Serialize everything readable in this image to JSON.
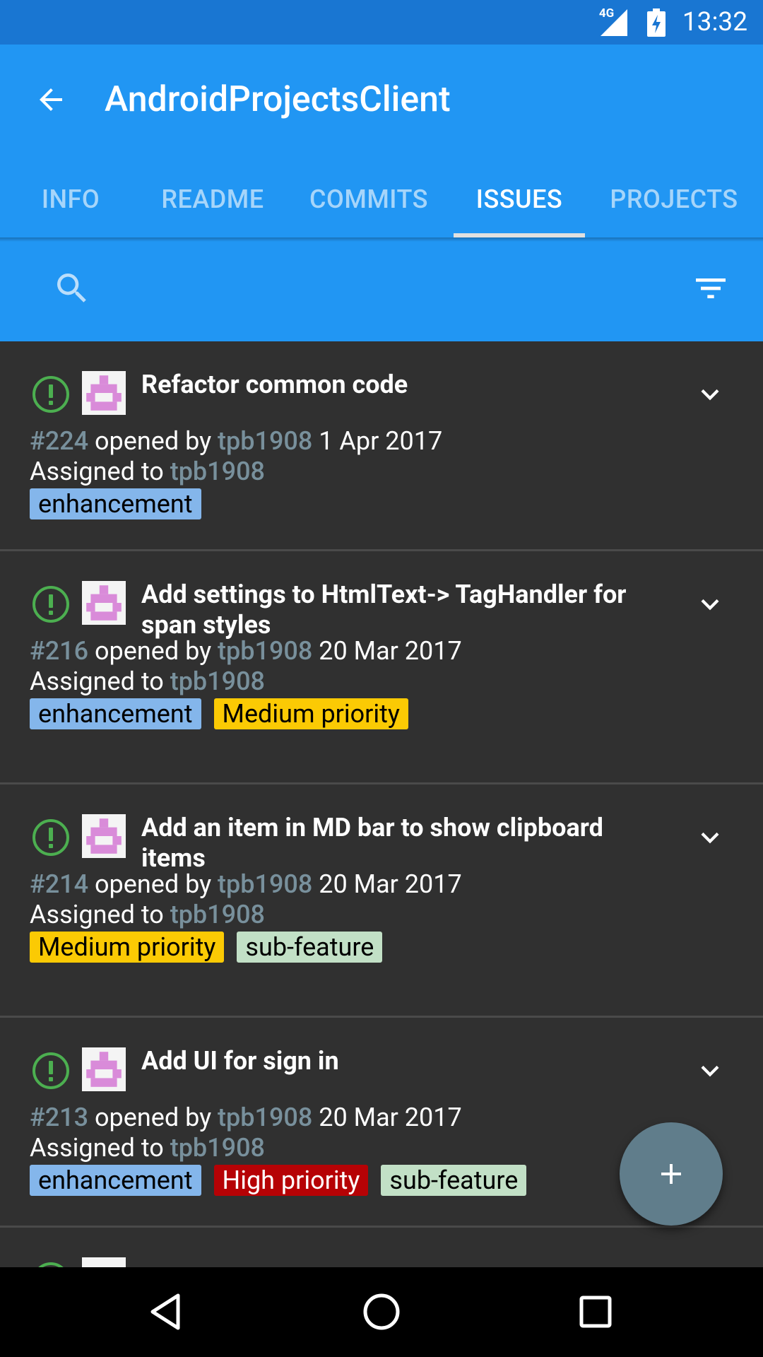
{
  "status_bar": {
    "network": "4G",
    "time": "13:32"
  },
  "app_bar": {
    "title": "AndroidProjectsClient"
  },
  "tabs": [
    {
      "label": "INFO",
      "active": false
    },
    {
      "label": "README",
      "active": false
    },
    {
      "label": "COMMITS",
      "active": false
    },
    {
      "label": "ISSUES",
      "active": true
    },
    {
      "label": "PROJECTS",
      "active": false
    }
  ],
  "colors": {
    "primary": "#2196f3",
    "primary_dark": "#1976d2",
    "open_icon": "#4caf50",
    "link": "#78909c",
    "label_enhancement": "#84b6eb",
    "label_medium": "#fbca04",
    "label_high": "#b60205",
    "label_subfeature": "#c2e0c6"
  },
  "issues": [
    {
      "title": "Refactor common code",
      "number": "#224",
      "opened_by_text": " opened by ",
      "author": "tpb1908",
      "date": " 1 Apr 2017",
      "assigned_text": "Assigned to ",
      "assignee": "tpb1908",
      "labels": [
        {
          "name": "enhancement"
        }
      ]
    },
    {
      "title": "Add settings to HtmlText-> TagHandler for span styles",
      "number": "#216",
      "opened_by_text": " opened by ",
      "author": "tpb1908",
      "date": " 20 Mar 2017",
      "assigned_text": "Assigned to ",
      "assignee": "tpb1908",
      "labels": [
        {
          "name": "enhancement"
        },
        {
          "name": "Medium priority"
        }
      ]
    },
    {
      "title": "Add an item in MD bar to show clipboard items",
      "number": "#214",
      "opened_by_text": " opened by ",
      "author": "tpb1908",
      "date": " 20 Mar 2017",
      "assigned_text": "Assigned to ",
      "assignee": "tpb1908",
      "labels": [
        {
          "name": "Medium priority"
        },
        {
          "name": "sub-feature"
        }
      ]
    },
    {
      "title": "Add UI for sign in",
      "number": "#213",
      "opened_by_text": " opened by ",
      "author": "tpb1908",
      "date": " 20 Mar 2017",
      "assigned_text": "Assigned to ",
      "assignee": "tpb1908",
      "labels": [
        {
          "name": "enhancement"
        },
        {
          "name": "High priority"
        },
        {
          "name": "sub-feature"
        }
      ]
    }
  ],
  "icons": {
    "back": "arrow-back-icon",
    "search": "search-icon",
    "filter": "filter-list-icon",
    "issue_state": "issue-opened-icon",
    "expand": "chevron-down-icon",
    "fab": "add-icon",
    "nav_back": "nav-back-icon",
    "nav_home": "nav-home-icon",
    "nav_recents": "nav-recents-icon"
  }
}
